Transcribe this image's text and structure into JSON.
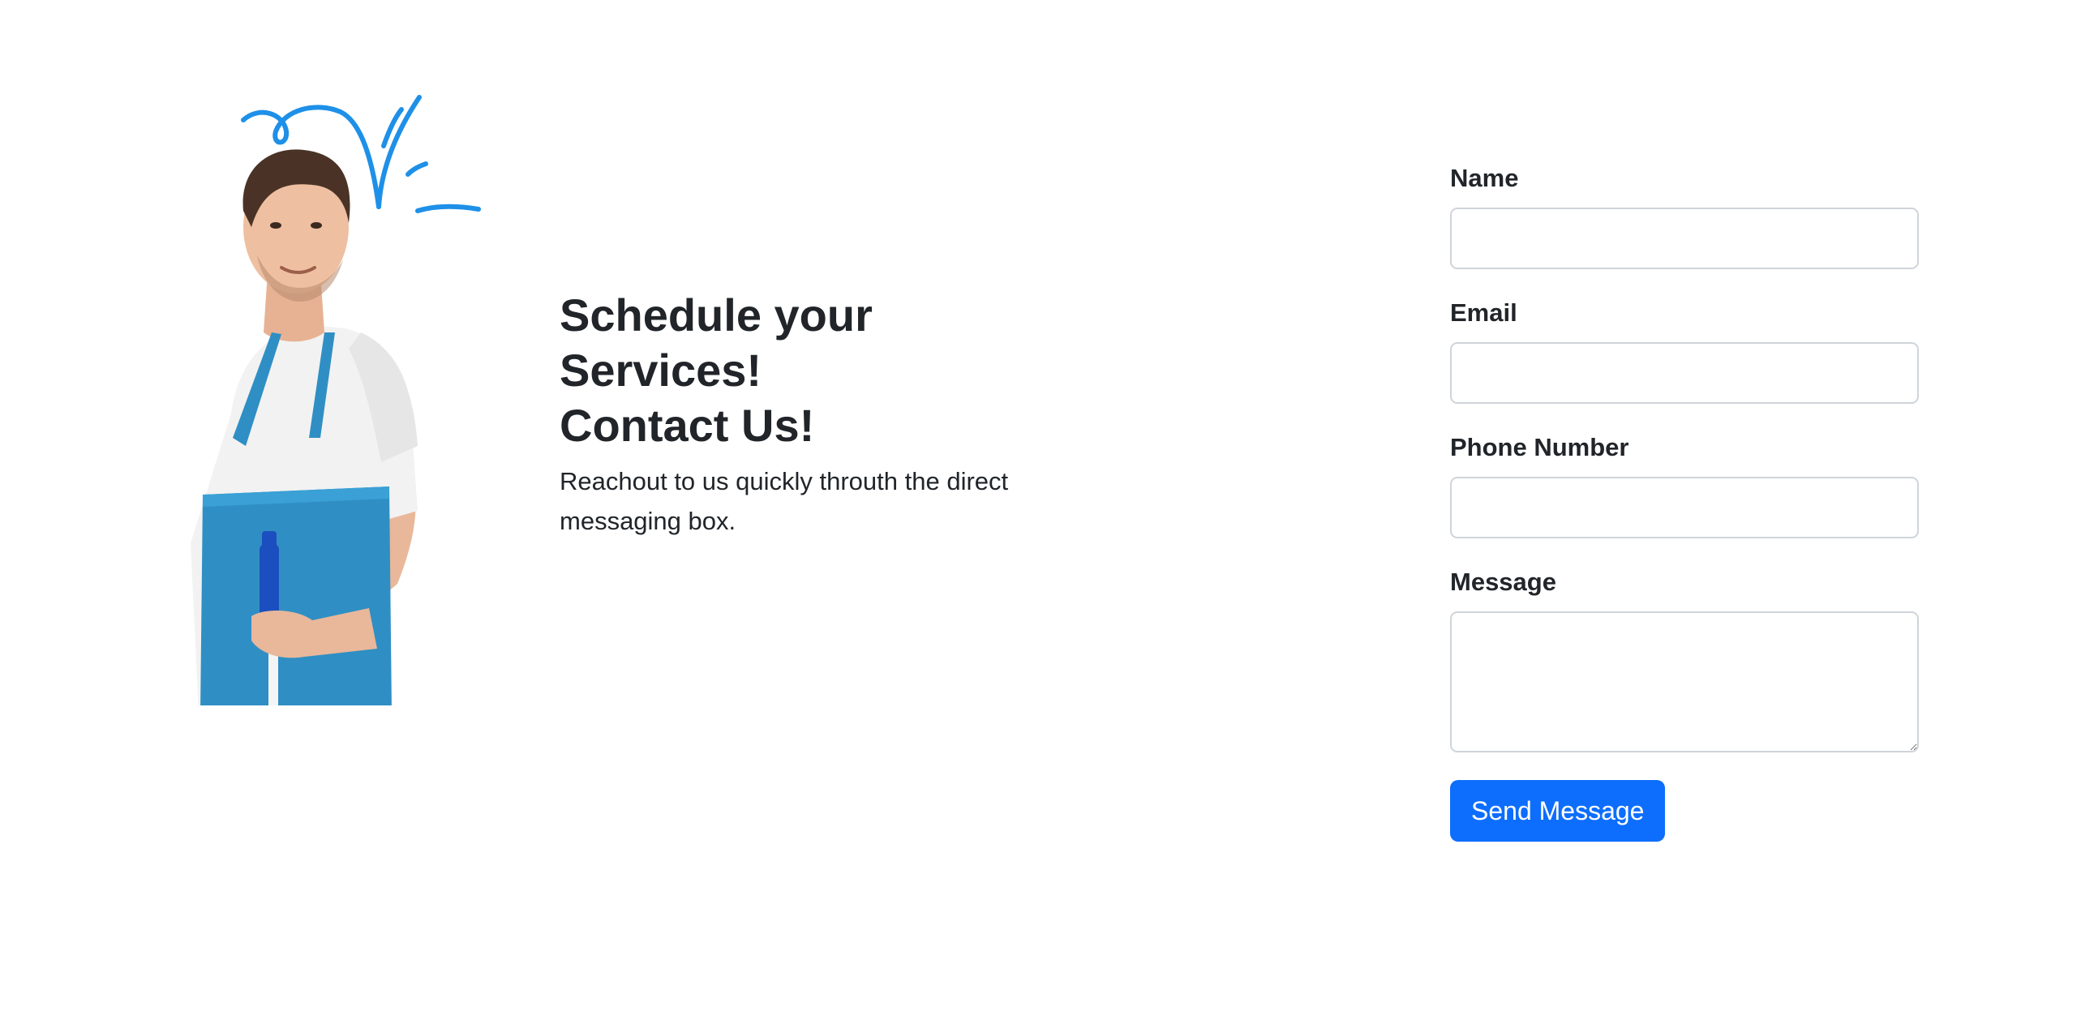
{
  "intro": {
    "heading": "Schedule your\nServices!\nContact Us!",
    "text": "Reachout to us quickly throuth the direct messaging box."
  },
  "illustration": {
    "icon": "cleaning-worker-with-spray-bottle",
    "accent_color": "#1e90e8",
    "apron_color": "#2f8fc4"
  },
  "form": {
    "fields": [
      {
        "label": "Name",
        "value": "",
        "placeholder": ""
      },
      {
        "label": "Email",
        "value": "",
        "placeholder": ""
      },
      {
        "label": "Phone Number",
        "value": "",
        "placeholder": ""
      },
      {
        "label": "Message",
        "value": "",
        "placeholder": ""
      }
    ],
    "submit_label": "Send Message",
    "accent_color": "#0d6efd"
  }
}
